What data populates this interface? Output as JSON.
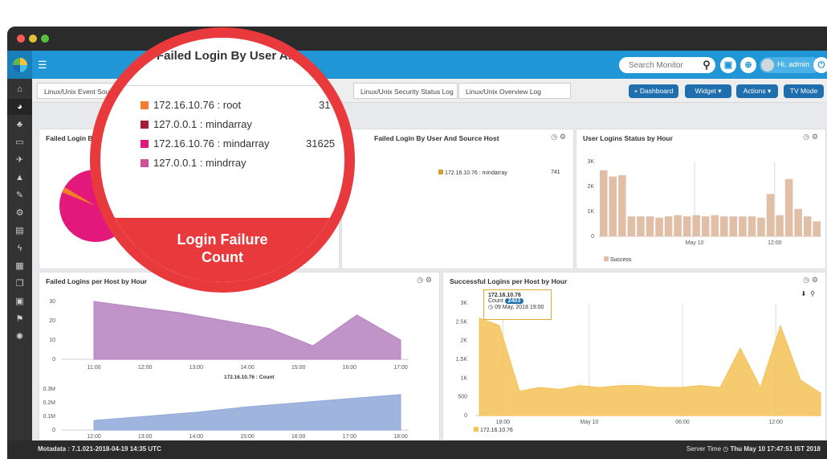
{
  "topbar": {
    "search_placeholder": "Search Monitor",
    "greeting": "Hi, admin"
  },
  "icons": {
    "sidebar": [
      "home-icon",
      "dashboard-icon",
      "sitemap-icon",
      "monitor-icon",
      "bullhorn-icon",
      "bell-icon",
      "plug-icon",
      "cogs-icon",
      "report-icon",
      "bolt-icon",
      "calendar-icon",
      "copy-icon",
      "file-icon",
      "flag-icon",
      "settings-icon"
    ]
  },
  "tabs": [
    {
      "label": "Linux/Unix Event Source"
    },
    {
      "label": "Linux/Unix Security Status Log"
    },
    {
      "label": "Linux/Unix Overview Log"
    }
  ],
  "actions": {
    "dashboard": "+ Dashboard",
    "widget": "Widget ▾",
    "actions": "Actions ▾",
    "tv_mode": "TV Mode"
  },
  "panels": {
    "failed_login_by_user": {
      "title": "Failed Login By User And Source Host"
    },
    "failed_login_by_user_2": {
      "title": "Failed Login By User And Source Host",
      "legend_label": "172.16.10.76 : mindarray",
      "legend_value": "741"
    },
    "user_logins_status": {
      "title": "User Logins Status by Hour",
      "legend": "Success"
    },
    "failed_logins_per_host": {
      "title": "Failed Logins per Host by Hour",
      "sub_title": "172.16.10.76 : Count"
    },
    "successful_logins_per_host": {
      "title": "Successful Logins per Host by Hour",
      "legend": "172.16.10.76"
    }
  },
  "tooltip": {
    "host": "172.16.10.76",
    "count_label": "Count",
    "count_value": "2403",
    "time": "09 May, 2018 19:00"
  },
  "magnifier": {
    "title": "Failed Login By User And Source Host",
    "entries": [
      {
        "label": "172.16.10.76 : root",
        "value": "31",
        "color": "#f07c2c"
      },
      {
        "label": "127.0.0.1 : mindarray",
        "value": "",
        "color": "#a61d3a"
      },
      {
        "label": "172.16.10.76 : mindarray",
        "value": "31625",
        "color": "#e2197a"
      },
      {
        "label": "127.0.0.1 : mindrray",
        "value": "",
        "color": "#d0509b"
      }
    ],
    "caption_line1": "Login Failure",
    "caption_line2": "Count"
  },
  "footer": {
    "version": "Motadata : 7.1.021-2018-04-19 14:35 UTC",
    "server_time_label": "Server Time",
    "server_time": "Thu May 10 17:47:51 IST 2018"
  },
  "chart_data": [
    {
      "type": "bar",
      "title": "User Logins Status by Hour",
      "series": [
        {
          "name": "Success",
          "values": [
            2650,
            2400,
            2450,
            800,
            800,
            800,
            750,
            800,
            850,
            800,
            850,
            800,
            850,
            800,
            800,
            800,
            800,
            750,
            1700,
            850,
            2300,
            1100,
            800,
            600
          ]
        }
      ],
      "x_tick_labels": [
        "May 10",
        "12:00"
      ],
      "y_tick_labels": [
        "0",
        "1K",
        "2K",
        "3K"
      ],
      "ylim": [
        0,
        3000
      ],
      "color": "#e0bfa6"
    },
    {
      "type": "area",
      "title": "Failed Logins per Host by Hour",
      "x": [
        "11:00",
        "12:00",
        "13:00",
        "14:00",
        "15:00",
        "16:00",
        "17:00"
      ],
      "values": [
        30,
        27,
        24,
        20,
        16,
        7,
        23,
        10
      ],
      "y_tick_labels": [
        "0",
        "10",
        "20",
        "30"
      ],
      "ylim": [
        0,
        30
      ],
      "color": "#b681bf"
    },
    {
      "type": "area",
      "title": "172.16.10.76 : Count",
      "x": [
        "12:00",
        "13:00",
        "14:00",
        "15:00",
        "16:00",
        "17:00",
        "18:00"
      ],
      "values": [
        0.07,
        0.1,
        0.13,
        0.17,
        0.2,
        0.23,
        0.26
      ],
      "y_tick_labels": [
        "0",
        "0.1M",
        "0.2M",
        "0.3M"
      ],
      "ylim": [
        0,
        0.3
      ],
      "color": "#8fa8d8"
    },
    {
      "type": "area",
      "title": "Successful Logins per Host by Hour",
      "series": [
        {
          "name": "172.16.10.76",
          "values": [
            2600,
            2403,
            650,
            750,
            700,
            800,
            750,
            800,
            800,
            750,
            750,
            800,
            750,
            1800,
            750,
            2400,
            950,
            600
          ]
        }
      ],
      "x_tick_labels": [
        "18:00",
        "May 10",
        "06:00",
        "12:00"
      ],
      "y_tick_labels": [
        "0",
        "500",
        "1K",
        "1.5K",
        "2K",
        "2.5K",
        "3K"
      ],
      "ylim": [
        0,
        3000
      ],
      "color": "#f5c257"
    }
  ]
}
